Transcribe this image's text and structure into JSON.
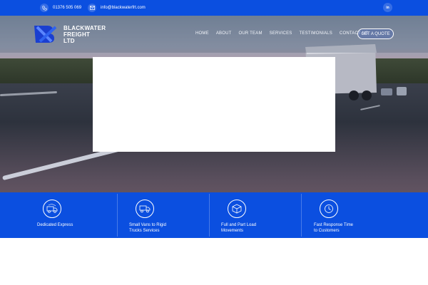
{
  "topbar": {
    "phone": "01376 505 069",
    "email": "info@blackwaterfrt.com",
    "linkedin_label": "in",
    "icons": [
      "phone-icon",
      "email-icon",
      "linkedin-icon"
    ]
  },
  "brand": {
    "logo_line1": "BLACKWATER",
    "logo_line2": "FREIGHT",
    "logo_line3": "LTD"
  },
  "nav": {
    "items": [
      "HOME",
      "ABOUT",
      "OUR TEAM",
      "SERVICES",
      "TESTIMONIALS",
      "CONTACT US"
    ],
    "cta": "GET A QUOTE"
  },
  "features": [
    {
      "icon": "express-delivery-icon",
      "label": "Dedicated Express"
    },
    {
      "icon": "truck-icon",
      "label": "Small Vans to Rigid Trucks Services"
    },
    {
      "icon": "package-icon",
      "label": "Full and Part Load Movements"
    },
    {
      "icon": "response-time-icon",
      "label": "Fast Response Time to Customers"
    }
  ],
  "colors": {
    "primary": "#0b4fe0",
    "white": "#ffffff"
  }
}
